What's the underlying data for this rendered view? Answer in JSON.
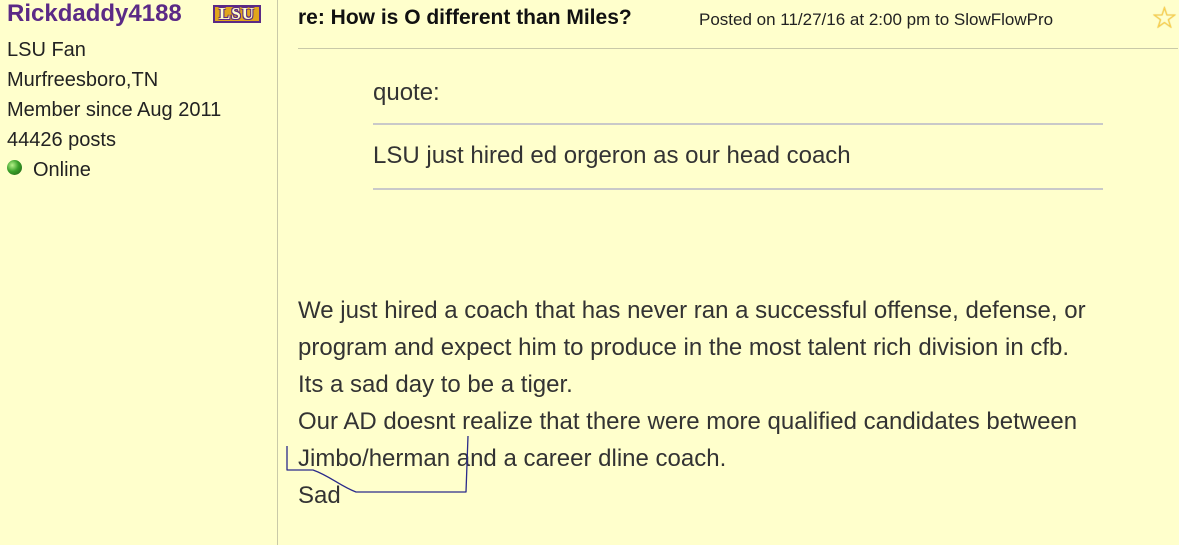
{
  "user": {
    "username": "Rickdaddy4188",
    "team_logo_text": "LSU",
    "fan_of": "LSU Fan",
    "location": "Murfreesboro,TN",
    "member_since": "Member since Aug 2011",
    "posts": "44426 posts",
    "status": "Online"
  },
  "post": {
    "title": "re: How is O different than Miles?",
    "meta": "Posted on 11/27/16 at 2:00 pm to SlowFlowPro",
    "favorite_icon": "star-icon"
  },
  "quote": {
    "label": "quote:",
    "text": "LSU just hired ed orgeron as our head coach"
  },
  "body": {
    "lines": [
      "We just hired a coach that has never ran a successful offense, defense, or",
      "program and expect him to produce in the most talent rich division in cfb.",
      "Its a sad day to be a tiger.",
      "Our AD doesnt realize that there were more qualified candidates between",
      "Jimbo/herman and a career dline coach.",
      "Sad"
    ]
  },
  "colors": {
    "background": "#ffffcc",
    "username": "#5b2a86",
    "logo_gold": "#e0a51b",
    "text": "#333333",
    "divider": "#c9c9c9"
  }
}
